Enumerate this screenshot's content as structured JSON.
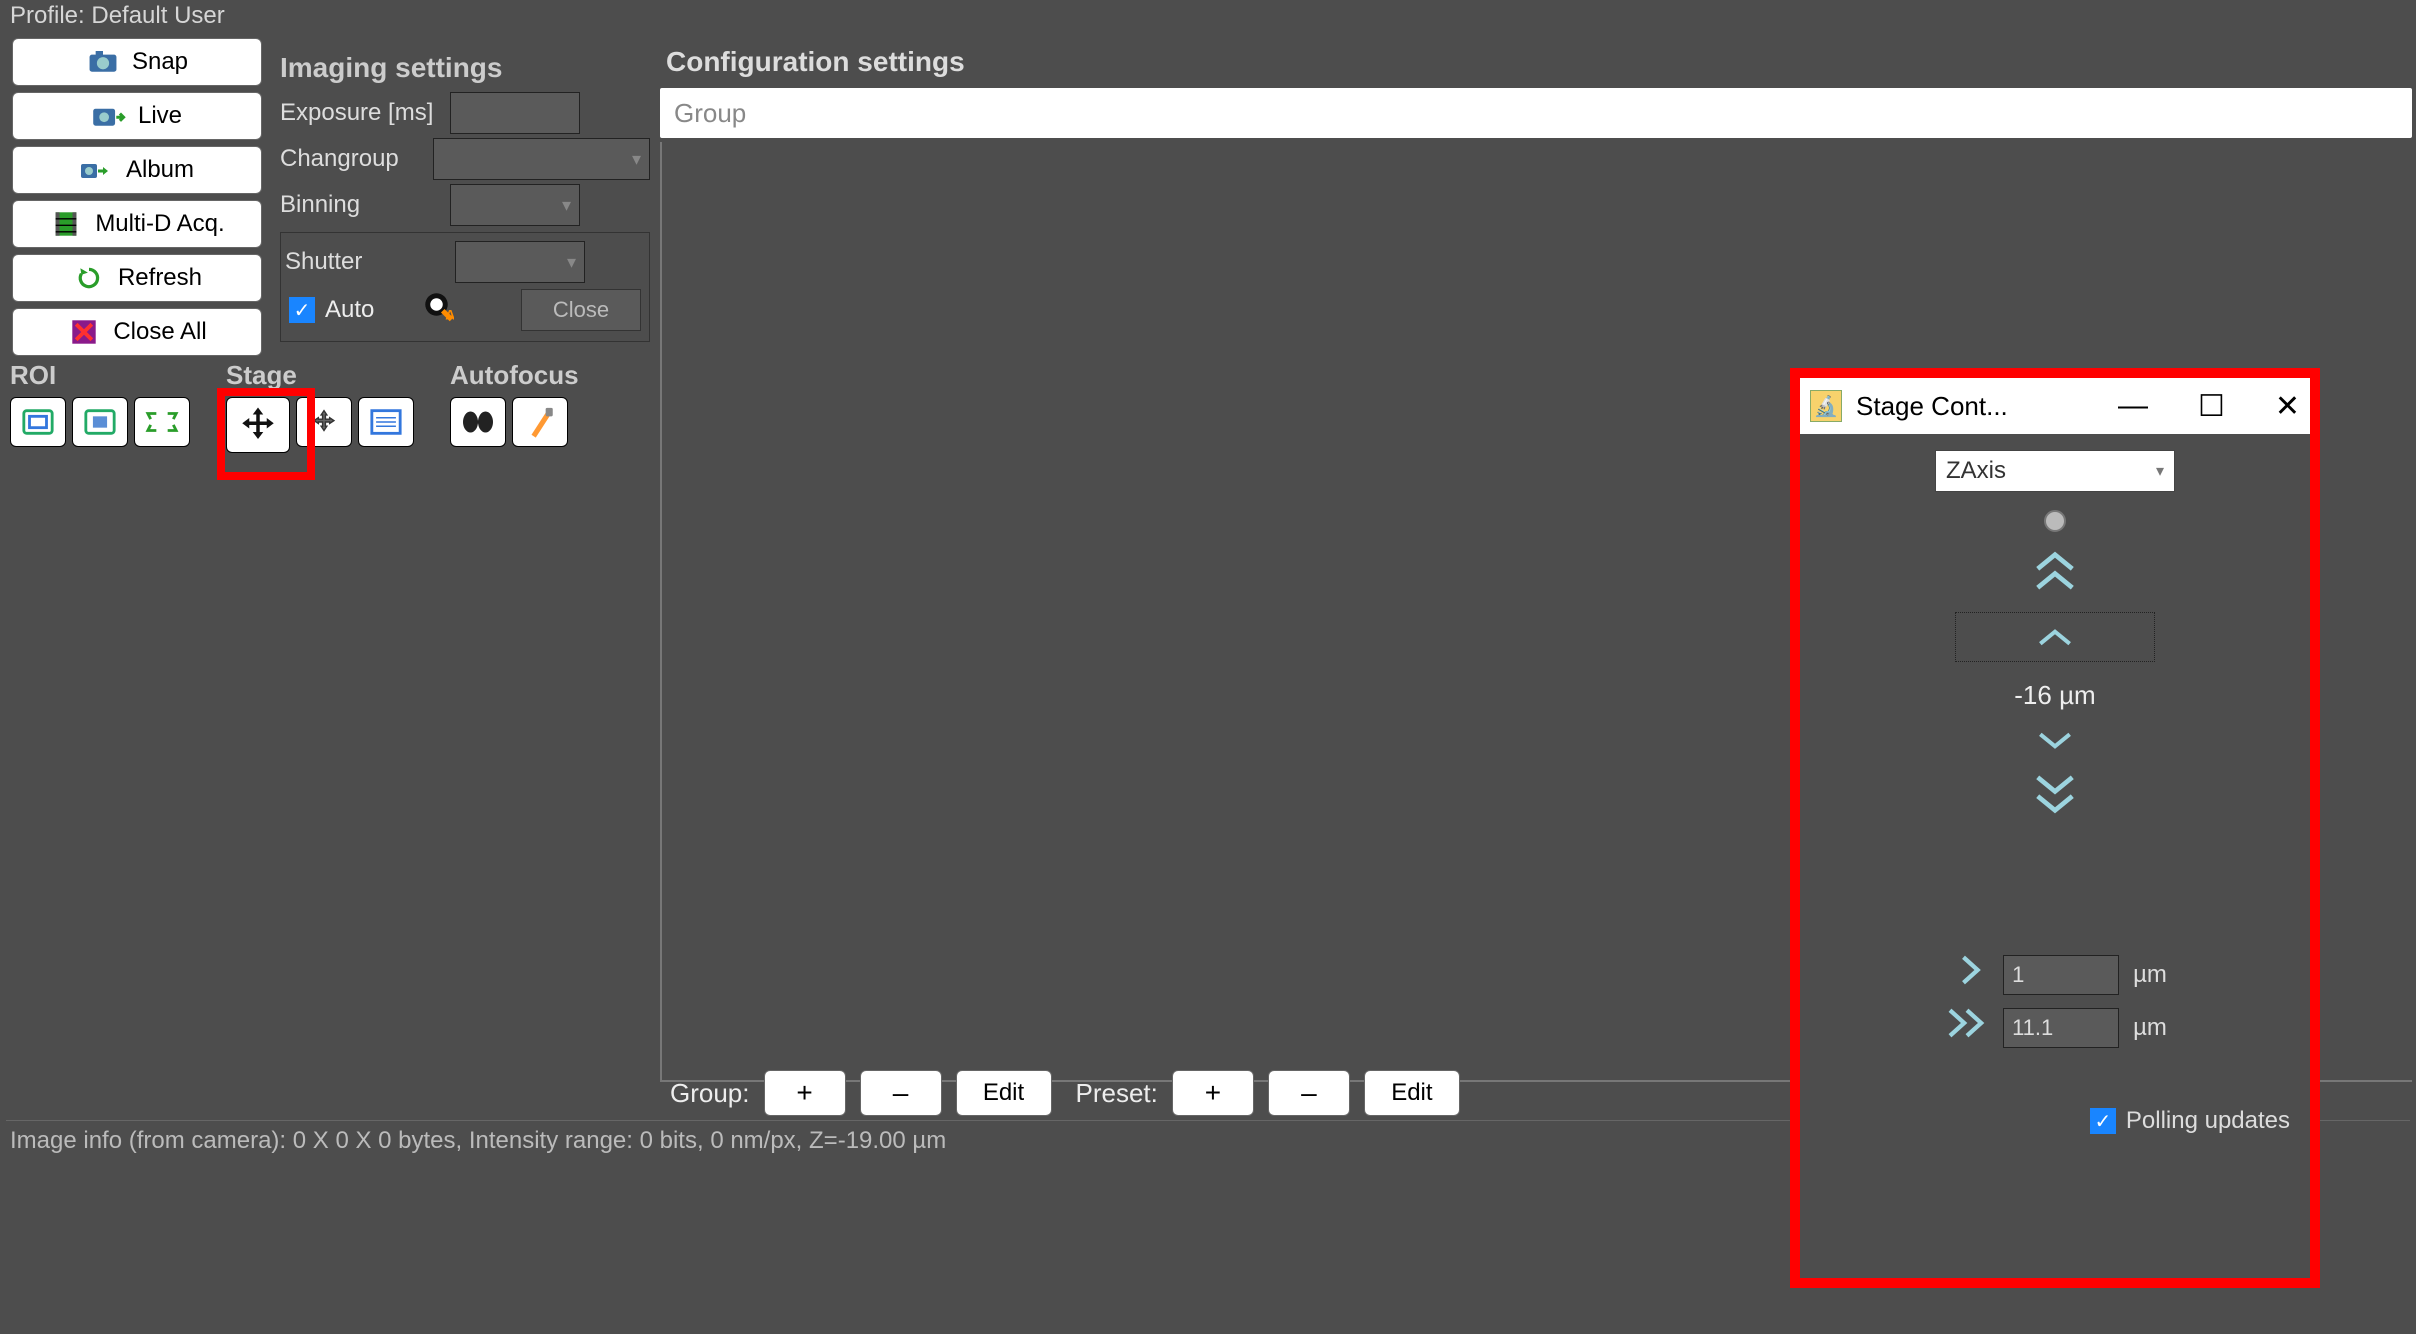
{
  "profile": {
    "label": "Profile: Default User"
  },
  "buttons": {
    "snap": "Snap",
    "live": "Live",
    "album": "Album",
    "multi_d": "Multi-D Acq.",
    "refresh": "Refresh",
    "close_all": "Close All"
  },
  "imaging": {
    "title": "Imaging settings",
    "exposure_label": "Exposure [ms]",
    "changroup_label": "Changroup",
    "binning_label": "Binning",
    "shutter_label": "Shutter",
    "auto_label": "Auto",
    "close_label": "Close"
  },
  "sections": {
    "roi": "ROI",
    "stage": "Stage",
    "autofocus": "Autofocus"
  },
  "config": {
    "title": "Configuration settings",
    "group_placeholder": "Group"
  },
  "groups_row": {
    "group_label": "Group:",
    "preset_label": "Preset:",
    "plus": "+",
    "minus": "–",
    "edit": "Edit"
  },
  "status": {
    "text": "Image info (from camera): 0 X 0 X 0 bytes, Intensity range: 0 bits, 0 nm/px, Z=-19.00 µm"
  },
  "stage_dialog": {
    "title": "Stage Cont...",
    "axis_selected": "ZAxis",
    "z_position": "-16 µm",
    "step_unit": "µm",
    "step_small": "1",
    "step_large": "11.1",
    "polling_label": "Polling updates"
  }
}
